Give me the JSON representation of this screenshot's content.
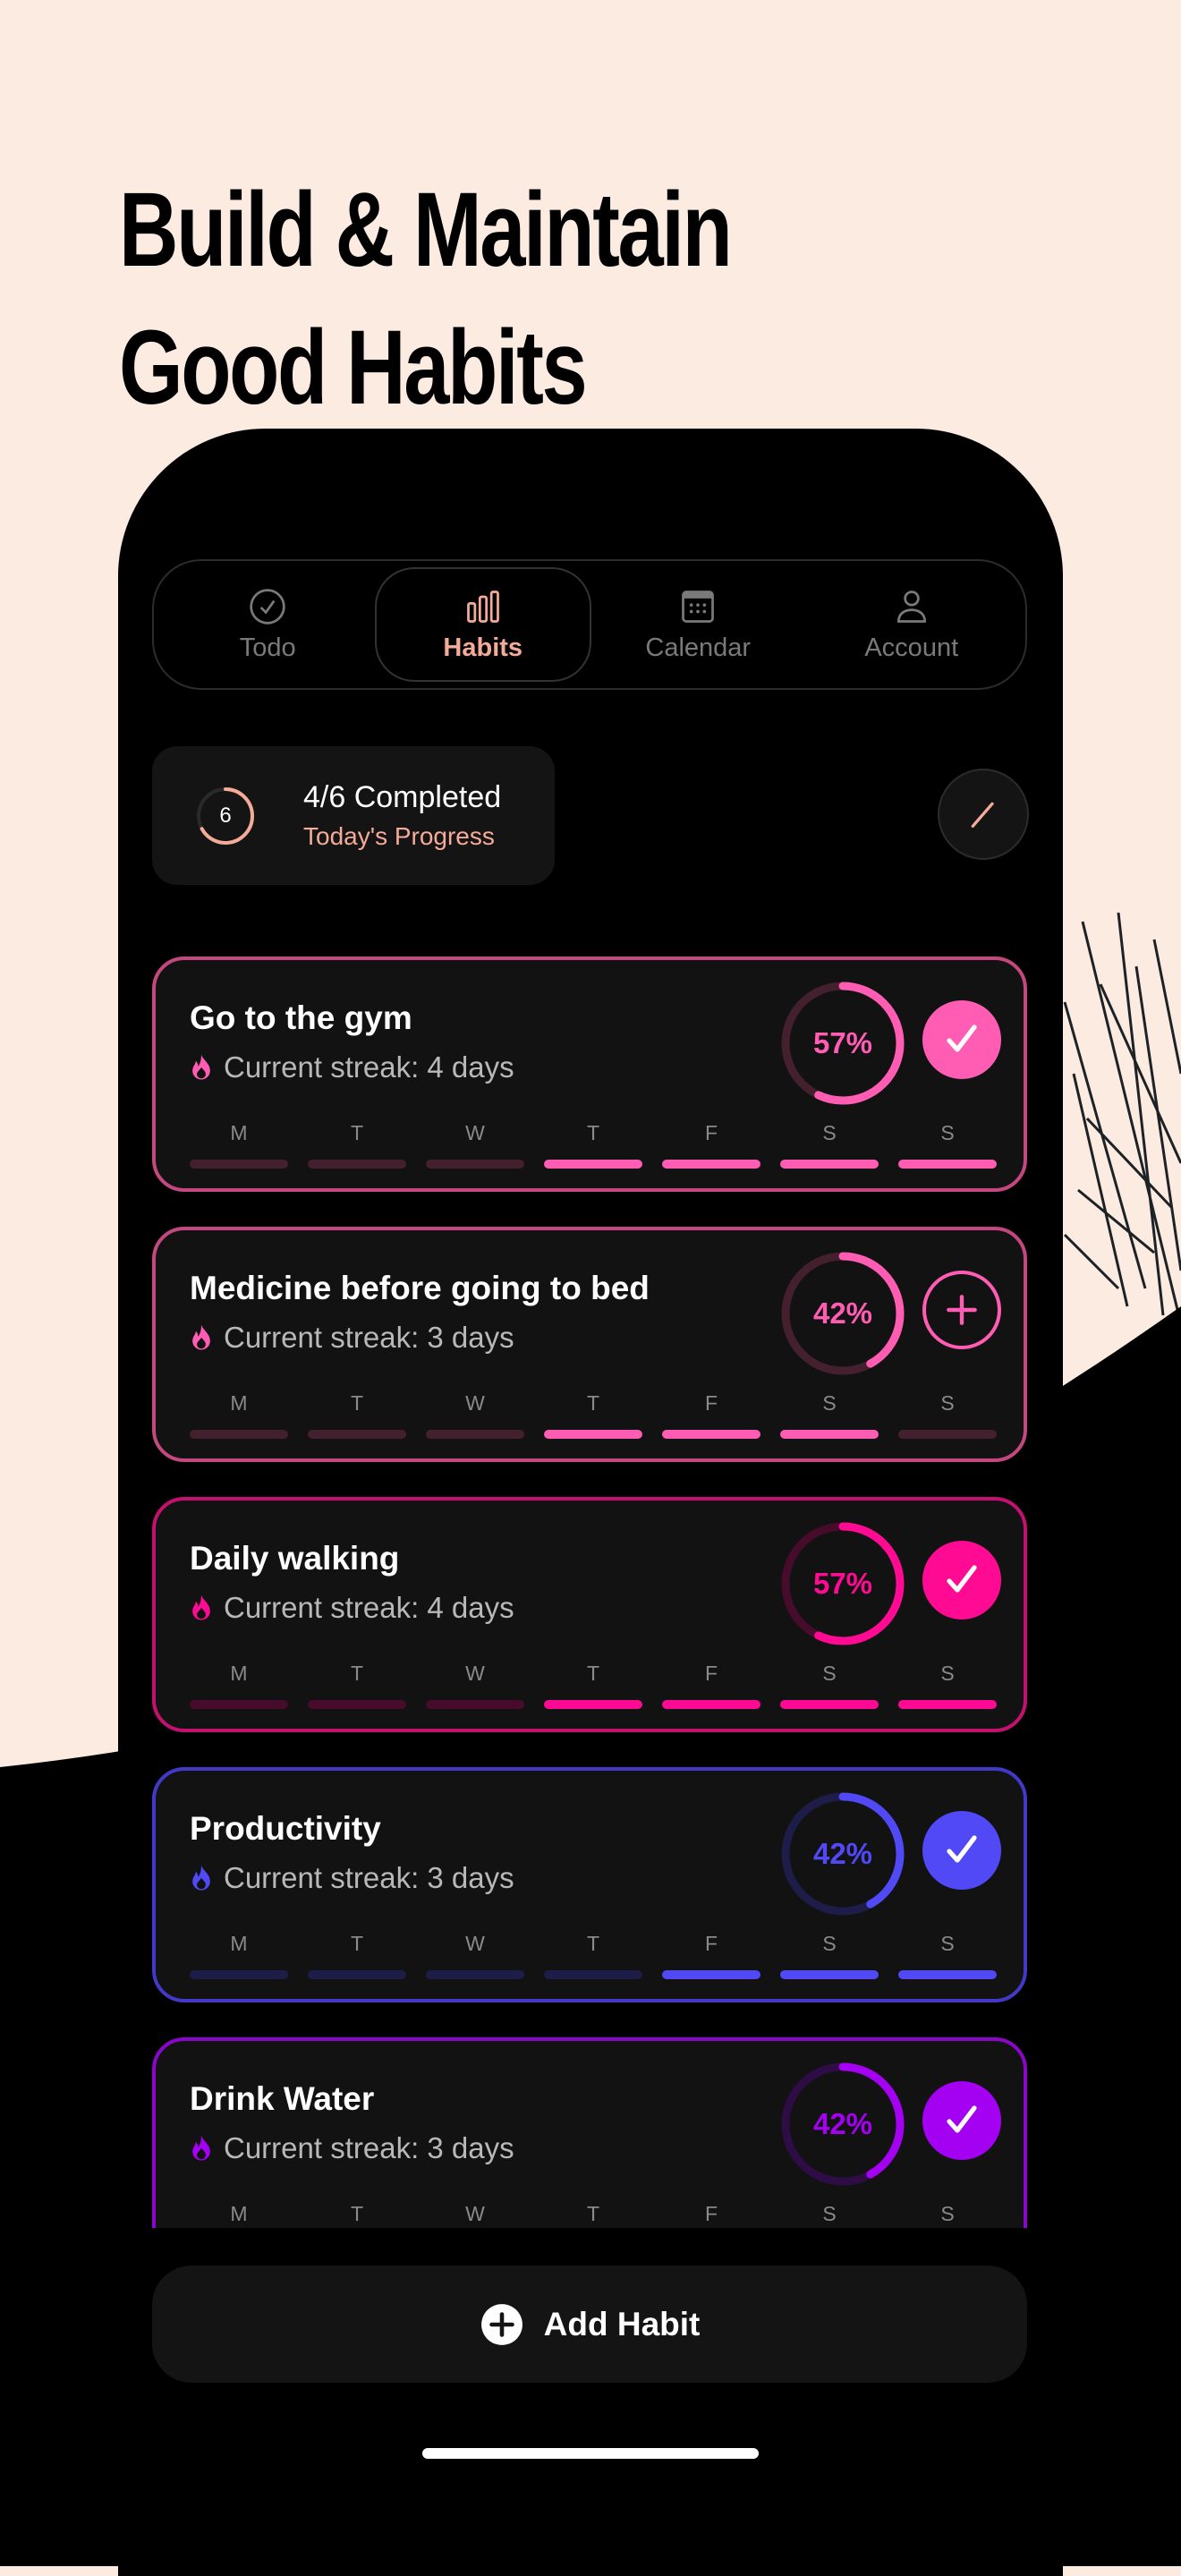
{
  "headline": {
    "line1": "Build & Maintain",
    "line2": "Good Habits"
  },
  "colors": {
    "background": "#fcebe0",
    "accent": "#f4ab97"
  },
  "tabs": [
    {
      "label": "Todo",
      "icon": "check-circle-icon",
      "selected": false
    },
    {
      "label": "Habits",
      "icon": "bar-chart-icon",
      "selected": true
    },
    {
      "label": "Calendar",
      "icon": "calendar-icon",
      "selected": false
    },
    {
      "label": "Account",
      "icon": "person-icon",
      "selected": false
    }
  ],
  "progress": {
    "ring_number": "6",
    "title": "4/6 Completed",
    "subtitle": "Today's Progress",
    "fraction": 0.67
  },
  "edit_icon": "pencil-icon",
  "day_labels": [
    "M",
    "T",
    "W",
    "T",
    "F",
    "S",
    "S"
  ],
  "habits": [
    {
      "name": "Go to the gym",
      "streak": "Current streak: 4 days",
      "percent": "57%",
      "value": 0.57,
      "color": "#ff5cb4",
      "dim": "#44202f",
      "border": "#c4477f",
      "action": "check",
      "done": [
        0,
        0,
        0,
        1,
        1,
        1,
        1
      ]
    },
    {
      "name": "Medicine before going to bed",
      "streak": "Current streak: 3 days",
      "percent": "42%",
      "value": 0.42,
      "color": "#ff5cb4",
      "dim": "#44202f",
      "border": "#c4477f",
      "action": "add",
      "done": [
        0,
        0,
        0,
        1,
        1,
        1,
        0
      ]
    },
    {
      "name": "Daily walking",
      "streak": "Current streak: 4 days",
      "percent": "57%",
      "value": 0.57,
      "color": "#ff0a93",
      "dim": "#470b2b",
      "border": "#c4106f",
      "action": "check",
      "done": [
        0,
        0,
        0,
        1,
        1,
        1,
        1
      ]
    },
    {
      "name": "Productivity",
      "streak": "Current streak: 3 days",
      "percent": "42%",
      "value": 0.42,
      "color": "#5149f6",
      "dim": "#1e1c48",
      "border": "#4339c8",
      "action": "check",
      "done": [
        0,
        0,
        0,
        0,
        1,
        1,
        1
      ]
    },
    {
      "name": "Drink Water",
      "streak": "Current streak: 3 days",
      "percent": "42%",
      "value": 0.42,
      "color": "#a400f2",
      "dim": "#2e0c45",
      "border": "#8a06c8",
      "action": "check",
      "done": [
        0,
        0,
        0,
        0,
        1,
        1,
        1
      ]
    }
  ],
  "add_button": {
    "label": "Add Habit",
    "icon": "plus-circle-icon"
  }
}
